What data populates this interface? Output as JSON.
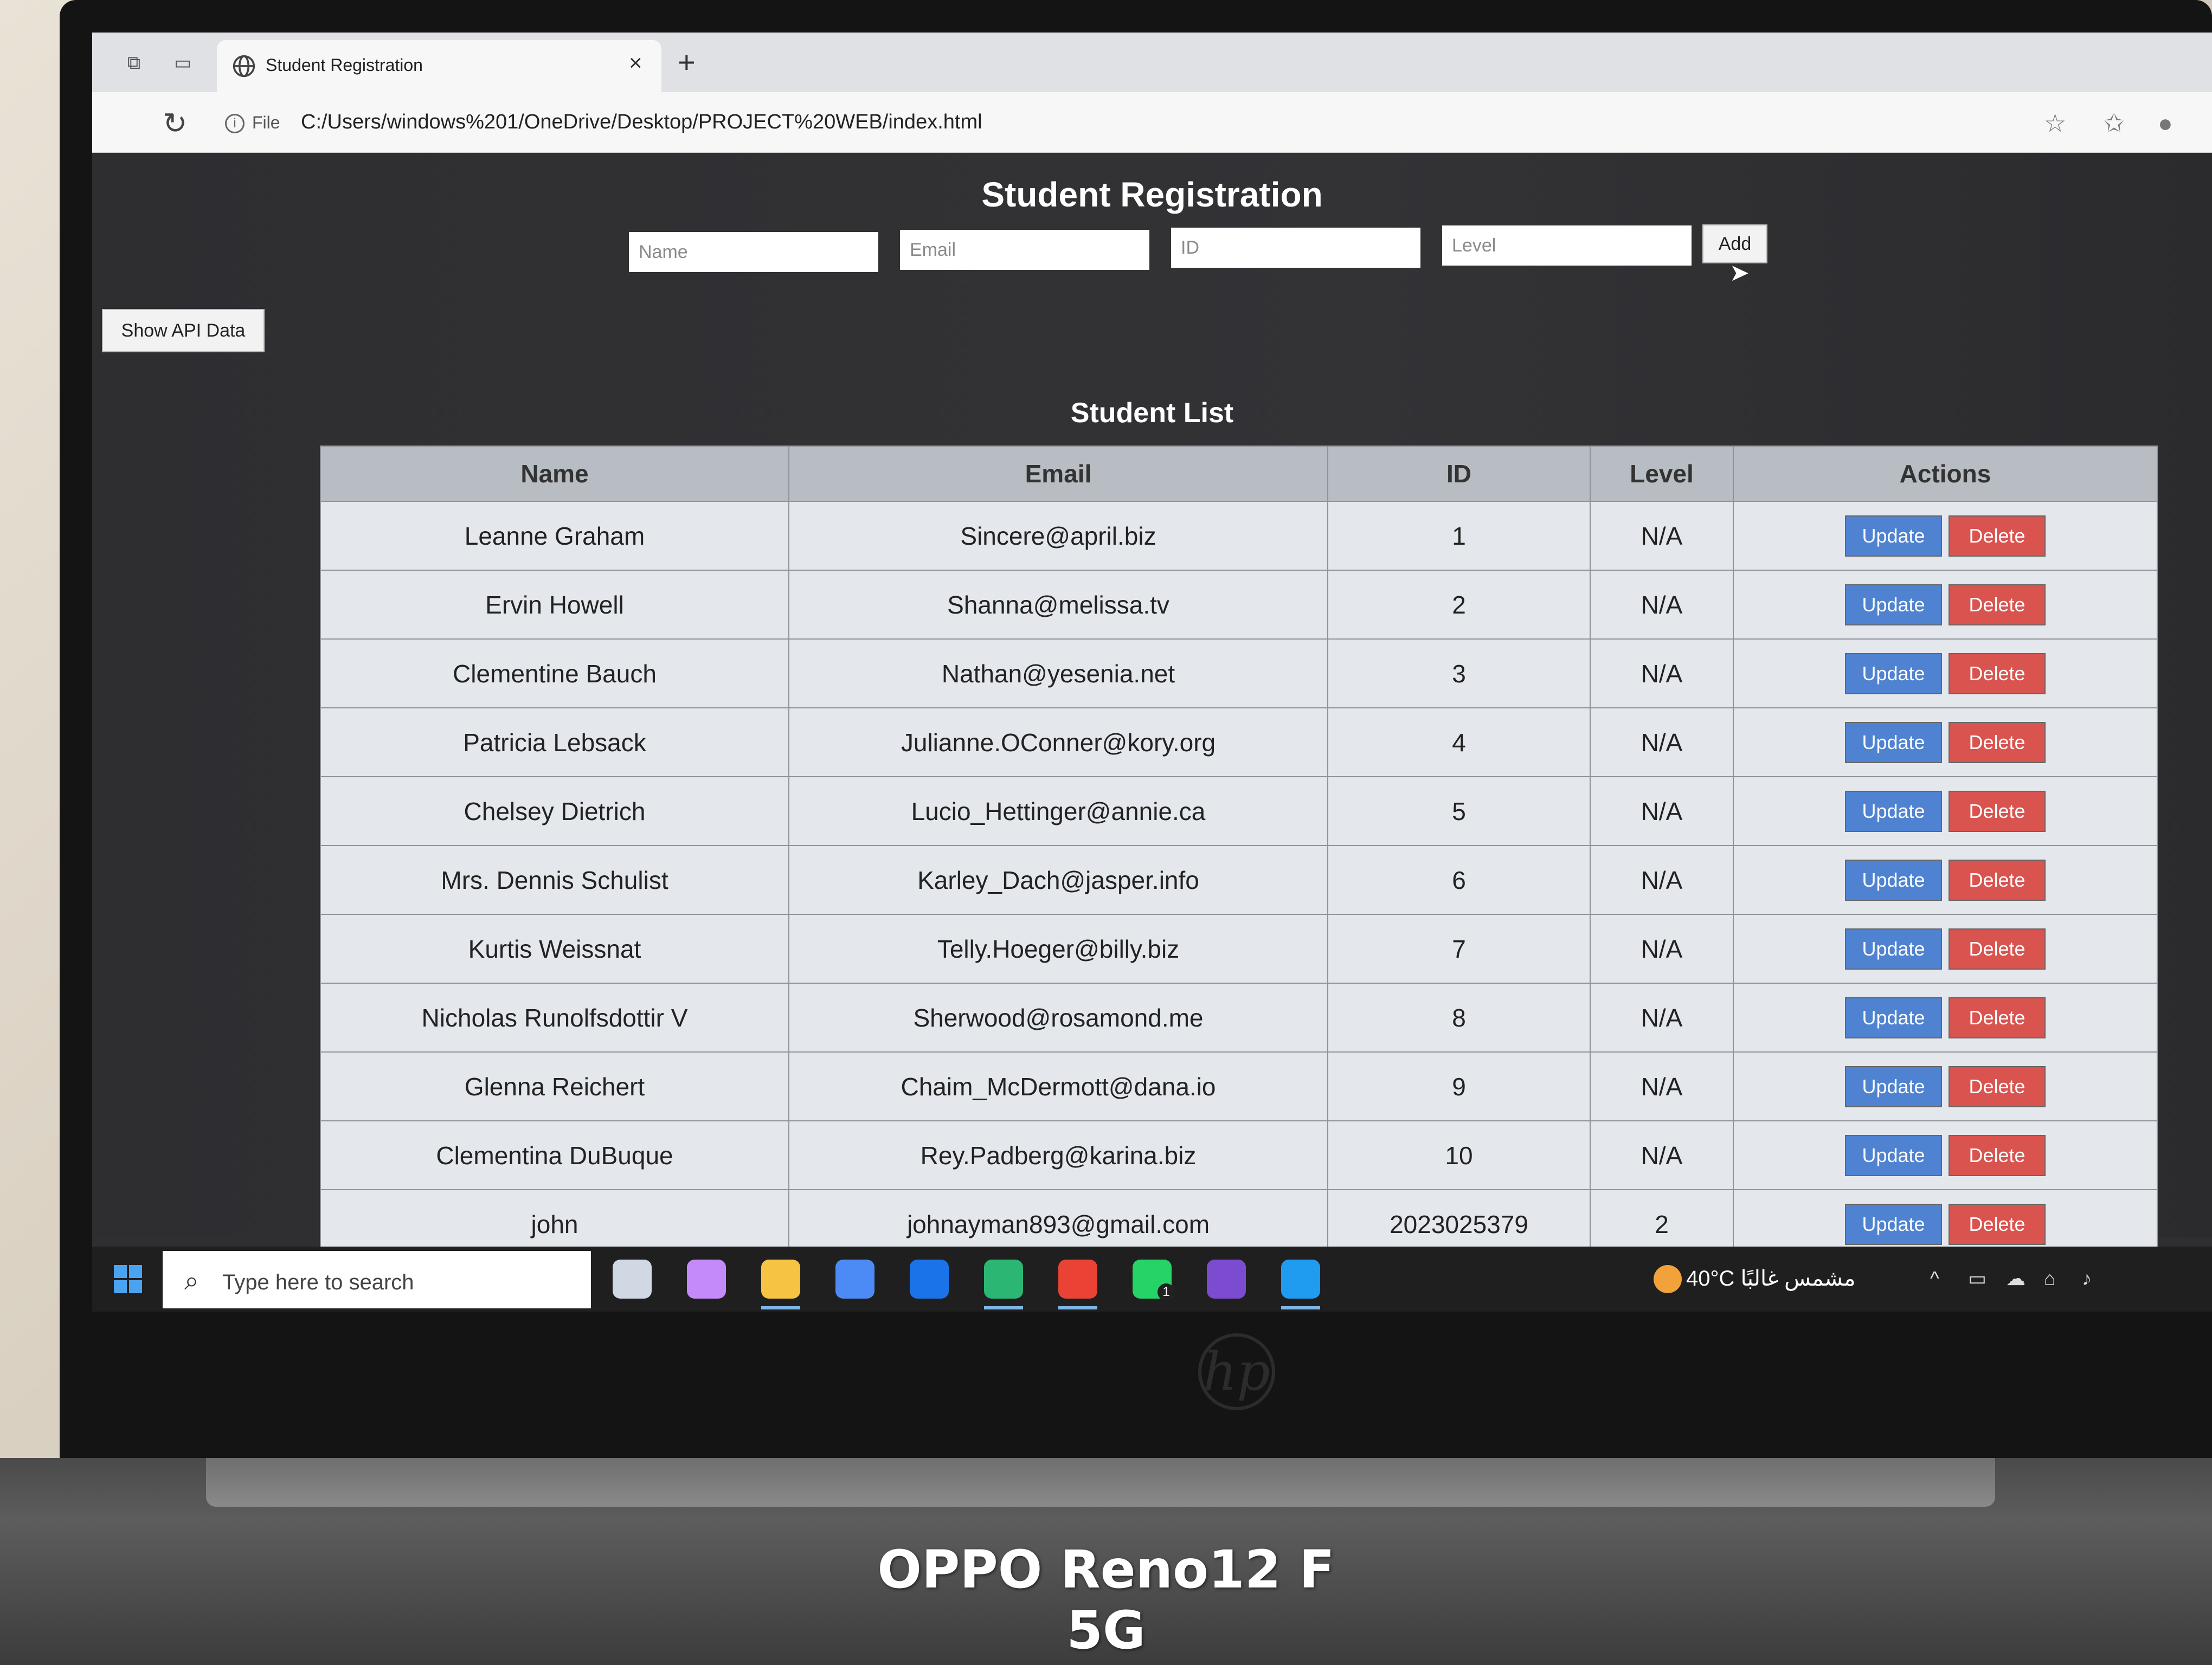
{
  "browser": {
    "tab_title": "Student Registration",
    "tab_close": "×",
    "new_tab": "+",
    "file_label": "File",
    "url": "C:/Users/windows%201/OneDrive/Desktop/PROJECT%20WEB/index.html"
  },
  "page": {
    "title": "Student Registration",
    "form": {
      "name_placeholder": "Name",
      "email_placeholder": "Email",
      "id_placeholder": "ID",
      "level_placeholder": "Level",
      "add_label": "Add"
    },
    "show_api_label": "Show API Data",
    "list_title": "Student List",
    "columns": [
      "Name",
      "Email",
      "ID",
      "Level",
      "Actions"
    ],
    "update_label": "Update",
    "delete_label": "Delete",
    "rows": [
      {
        "name": "Leanne Graham",
        "email": "Sincere@april.biz",
        "id": "1",
        "level": "N/A"
      },
      {
        "name": "Ervin Howell",
        "email": "Shanna@melissa.tv",
        "id": "2",
        "level": "N/A"
      },
      {
        "name": "Clementine Bauch",
        "email": "Nathan@yesenia.net",
        "id": "3",
        "level": "N/A"
      },
      {
        "name": "Patricia Lebsack",
        "email": "Julianne.OConner@kory.org",
        "id": "4",
        "level": "N/A"
      },
      {
        "name": "Chelsey Dietrich",
        "email": "Lucio_Hettinger@annie.ca",
        "id": "5",
        "level": "N/A"
      },
      {
        "name": "Mrs. Dennis Schulist",
        "email": "Karley_Dach@jasper.info",
        "id": "6",
        "level": "N/A"
      },
      {
        "name": "Kurtis Weissnat",
        "email": "Telly.Hoeger@billy.biz",
        "id": "7",
        "level": "N/A"
      },
      {
        "name": "Nicholas Runolfsdottir V",
        "email": "Sherwood@rosamond.me",
        "id": "8",
        "level": "N/A"
      },
      {
        "name": "Glenna Reichert",
        "email": "Chaim_McDermott@dana.io",
        "id": "9",
        "level": "N/A"
      },
      {
        "name": "Clementina DuBuque",
        "email": "Rey.Padberg@karina.biz",
        "id": "10",
        "level": "N/A"
      },
      {
        "name": "john",
        "email": "johnayman893@gmail.com",
        "id": "2023025379",
        "level": "2"
      }
    ]
  },
  "taskbar": {
    "search_placeholder": "Type here to search",
    "weather": "40°C مشمس غالبًا",
    "icons": [
      "task-view-icon",
      "copilot-icon",
      "file-explorer-icon",
      "store-icon",
      "outlook-icon",
      "edge-icon",
      "chrome-icon",
      "whatsapp-icon",
      "visual-studio-icon",
      "vscode-icon"
    ],
    "whatsapp_badge": "1"
  },
  "overlay": {
    "watermark": "OPPO Reno12 F 5G"
  },
  "colors": {
    "update_button": "#4f83d1",
    "delete_button": "#d9534f",
    "page_background": "#2f2f32",
    "table_header": "#b8bcc3"
  }
}
